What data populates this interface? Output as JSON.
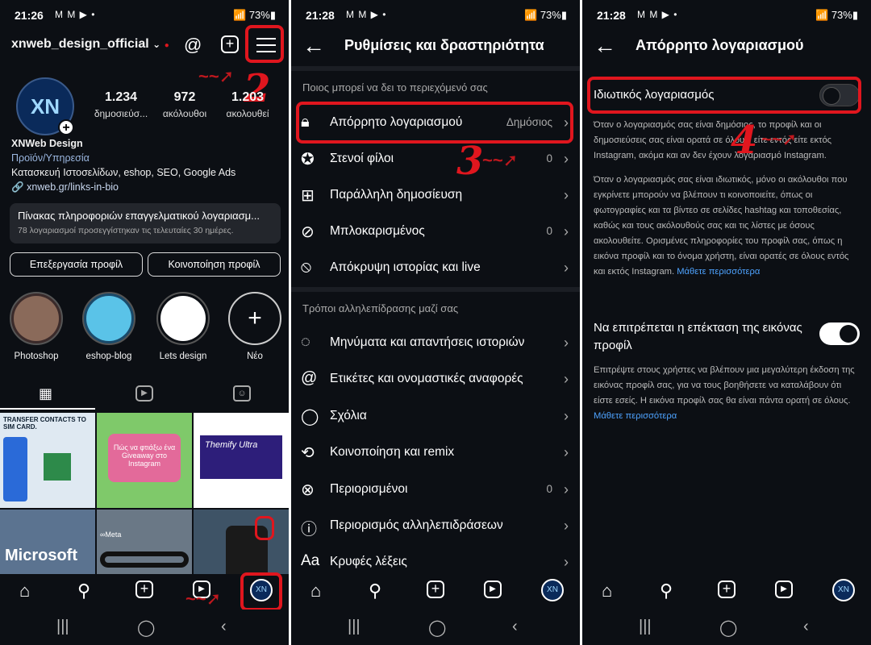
{
  "phone1": {
    "status": {
      "time": "21:26",
      "notifs": "M M ▶ •",
      "sys": "73%"
    },
    "username": "xnweb_design_official",
    "avatar_text": "XN",
    "stats": [
      {
        "n": "1.234",
        "l": "δημοσιεύσ..."
      },
      {
        "n": "972",
        "l": "ακόλουθοι"
      },
      {
        "n": "1.203",
        "l": "ακολουθεί"
      }
    ],
    "name": "XNWeb Design",
    "category": "Προϊόν/Υπηρεσία",
    "description": "Κατασκευή Ιστοσελίδων, eshop, SEO, Google Ads",
    "link": "xnweb.gr/links-in-bio",
    "dashboard_title": "Πίνακας πληροφοριών επαγγελματικού λογαριασμ...",
    "dashboard_sub": "78 λογαριασμοί προσεγγίστηκαν τις τελευταίες 30 ημέρες.",
    "edit_btn": "Επεξεργασία προφίλ",
    "share_btn": "Κοινοποίηση προφίλ",
    "highlights": [
      "Photoshop",
      "eshop-blog",
      "Lets design",
      "Νέο"
    ],
    "posts": [
      {
        "text": "TRANSFER CONTACTS TO SIM CARD."
      },
      {
        "text": "Πώς να φτιάξω ένα Giveaway στο Instagram"
      },
      {
        "text": "Themify Ultra"
      },
      {
        "text": "Microsoft"
      },
      {
        "text": "∞Meta"
      },
      {
        "text": ""
      }
    ],
    "annotation": "2"
  },
  "phone2": {
    "status": {
      "time": "21:28",
      "notifs": "M M ▶ •",
      "sys": "73%"
    },
    "title": "Ρυθμίσεις και δραστηριότητα",
    "section1": "Ποιος μπορεί να δει το περιεχόμενό σας",
    "rows1": [
      {
        "label": "Απόρρητο λογαριασμού",
        "value": "Δημόσιος",
        "icon": "lock-icon"
      },
      {
        "label": "Στενοί φίλοι",
        "value": "0",
        "icon": "star-icon"
      },
      {
        "label": "Παράλληλη δημοσίευση",
        "value": "",
        "icon": "grid-plus-icon"
      },
      {
        "label": "Μπλοκαρισμένος",
        "value": "0",
        "icon": "block-icon"
      },
      {
        "label": "Απόκρυψη ιστορίας και live",
        "value": "",
        "icon": "hide-icon"
      }
    ],
    "section2": "Τρόποι αλληλεπίδρασης μαζί σας",
    "rows2": [
      {
        "label": "Μηνύματα και απαντήσεις ιστοριών",
        "value": "",
        "icon": "messenger-icon"
      },
      {
        "label": "Ετικέτες και ονομαστικές αναφορές",
        "value": "",
        "icon": "at-icon"
      },
      {
        "label": "Σχόλια",
        "value": "",
        "icon": "comment-icon"
      },
      {
        "label": "Κοινοποίηση και remix",
        "value": "",
        "icon": "remix-icon"
      },
      {
        "label": "Περιορισμένοι",
        "value": "0",
        "icon": "restrict-icon"
      },
      {
        "label": "Περιορισμός αλληλεπιδράσεων",
        "value": "",
        "icon": "alert-icon"
      },
      {
        "label": "Κρυφές λέξεις",
        "value": "",
        "icon": "text-icon"
      }
    ],
    "annotation": "3"
  },
  "phone3": {
    "status": {
      "time": "21:28",
      "notifs": "M M ▶ •",
      "sys": "73%"
    },
    "title": "Απόρρητο λογαριασμού",
    "private_label": "Ιδιωτικός λογαριασμός",
    "private_on": false,
    "para1": "Όταν ο λογαριασμός σας είναι δημόσιος, το προφίλ και οι δημοσιεύσεις σας είναι ορατά σε όλους, είτε εντός είτε εκτός Instagram, ακόμα και αν δεν έχουν λογαριασμό Instagram.",
    "para2": "Όταν ο λογαριασμός σας είναι ιδιωτικός, μόνο οι ακόλουθοι που εγκρίνετε μπορούν να βλέπουν τι κοινοποιείτε, όπως οι φωτογραφίες και τα βίντεο σε σελίδες hashtag και τοποθεσίας, καθώς και τους ακόλουθούς σας και τις λίστες με όσους ακολουθείτε. Ορισμένες πληροφορίες του προφίλ σας, όπως η εικόνα προφίλ και το όνομα χρήστη, είναι ορατές σε όλους εντός και εκτός Instagram.",
    "learn_more": "Μάθετε περισσότερα",
    "expand_label": "Να επιτρέπεται η επέκταση της εικόνας προφίλ",
    "expand_on": true,
    "para3": "Επιτρέψτε στους χρήστες να βλέπουν μια μεγαλύτερη έκδοση της εικόνας προφίλ σας, για να τους βοηθήσετε να καταλάβουν ότι είστε εσείς. Η εικόνα προφίλ σας θα είναι πάντα ορατή σε όλους.",
    "annotation": "4"
  },
  "colors": {
    "bg": "#0c0f14",
    "accent_red": "#e0161e",
    "link": "#4ea3ff",
    "toggle_on": "#ffffff",
    "toggle_off": "#2a2d33"
  }
}
